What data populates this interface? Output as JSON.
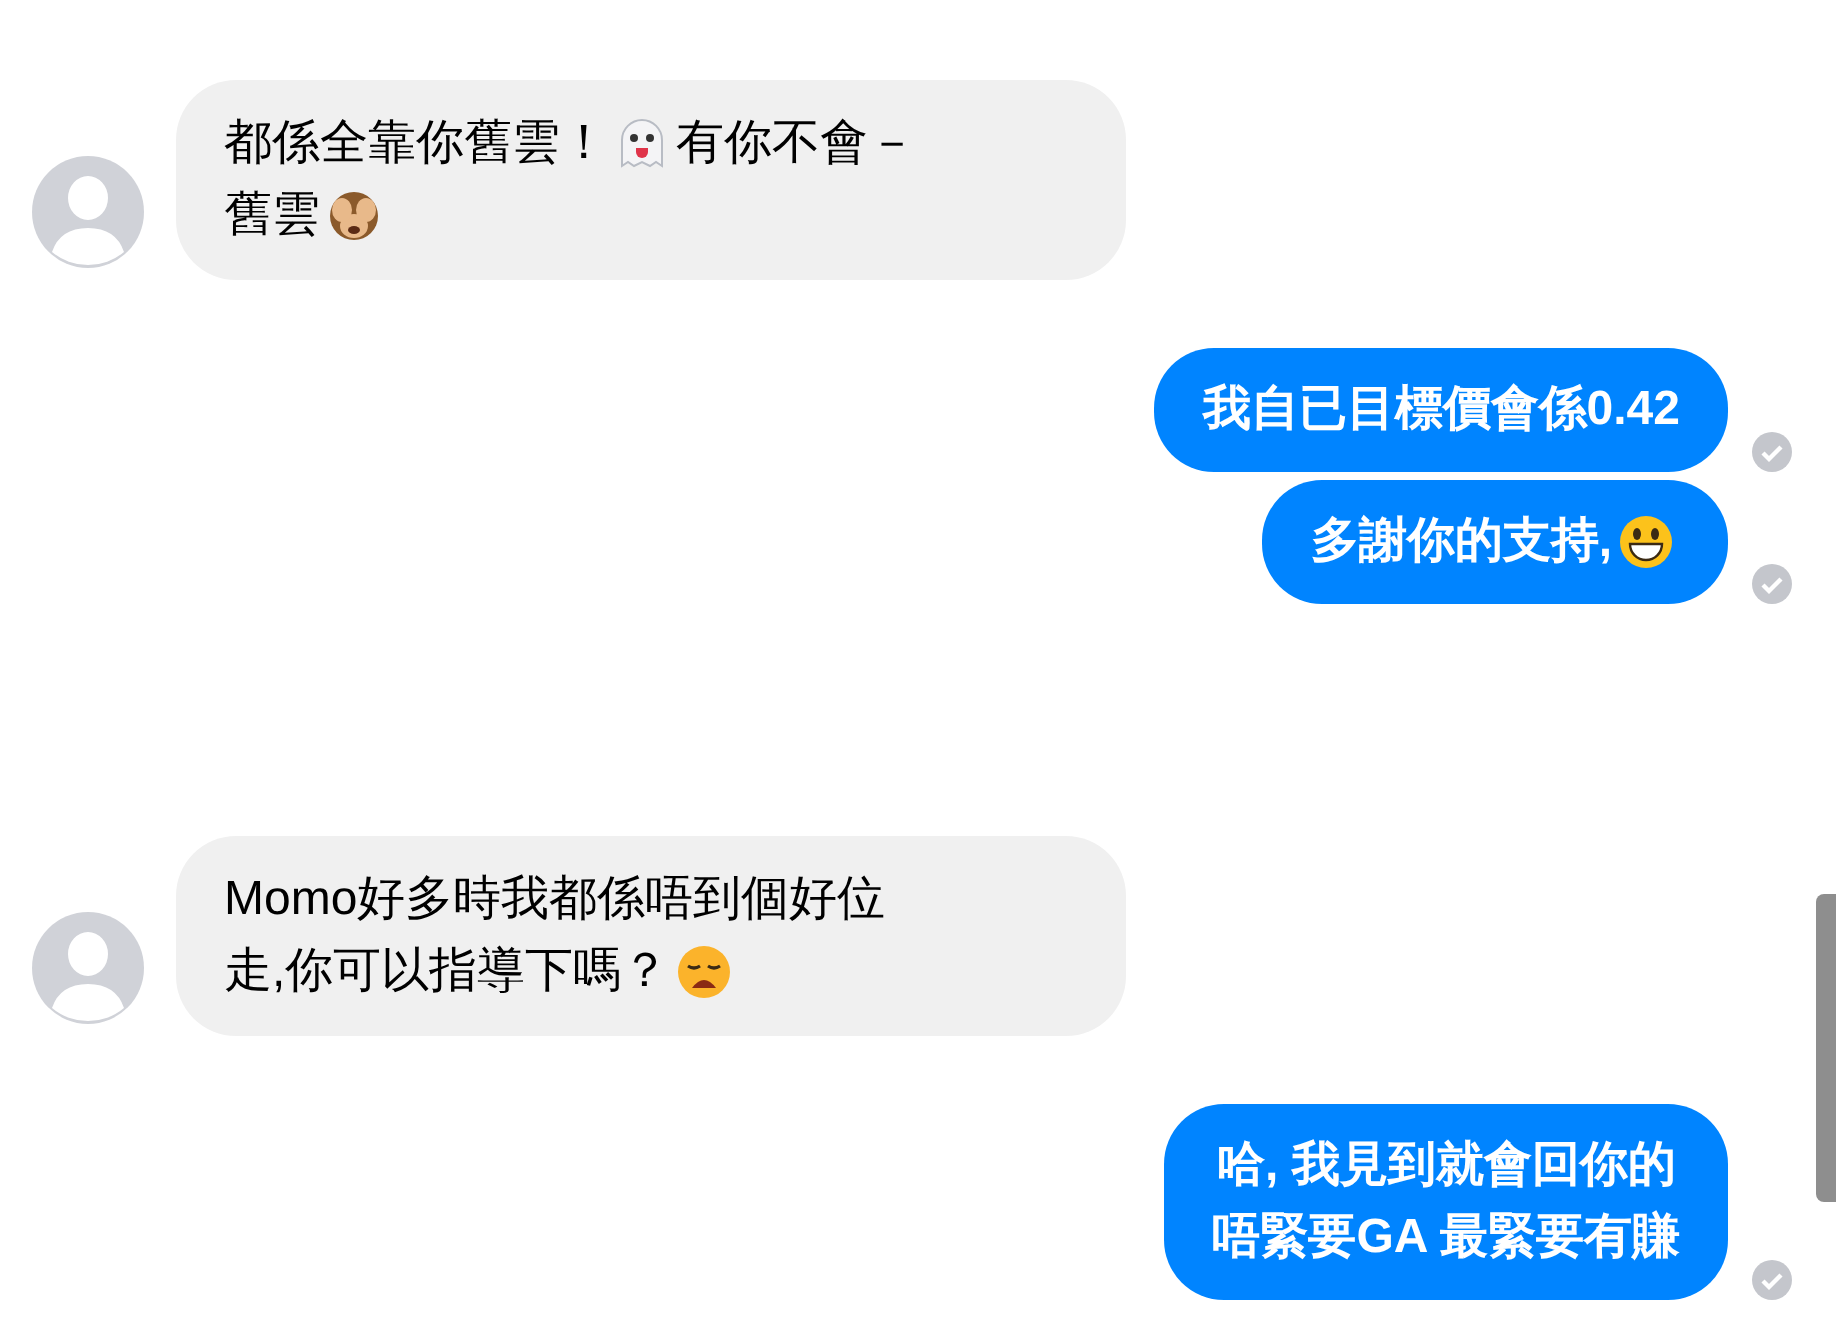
{
  "messages": [
    {
      "kind": "incoming",
      "lines": [
        [
          {
            "kind": "text",
            "text": "都係全靠你舊雲！"
          },
          {
            "kind": "ghost"
          },
          {
            "kind": "text",
            "text": "有你不會－"
          }
        ],
        [
          {
            "kind": "text",
            "text": "舊雲"
          },
          {
            "kind": "monkey"
          }
        ]
      ]
    },
    {
      "kind": "outgoing",
      "seen": true,
      "lines": [
        [
          {
            "kind": "text",
            "text": "我自已目標價會係0.42"
          }
        ]
      ]
    },
    {
      "kind": "outgoing",
      "seen": true,
      "lines": [
        [
          {
            "kind": "text",
            "text": "多謝你的支持,"
          },
          {
            "kind": "grin"
          }
        ]
      ]
    },
    {
      "kind": "incoming",
      "lines": [
        [
          {
            "kind": "text",
            "text": "Momo好多時我都係唔到個好位"
          }
        ],
        [
          {
            "kind": "text",
            "text": "走,你可以指導下嗎？"
          },
          {
            "kind": "weary"
          }
        ]
      ]
    },
    {
      "kind": "outgoing",
      "seen": true,
      "lines": [
        [
          {
            "kind": "text",
            "text": "哈, 我見到就會回你的"
          }
        ],
        [
          {
            "kind": "text",
            "text": "唔緊要GA 最緊要有賺"
          }
        ]
      ]
    }
  ]
}
